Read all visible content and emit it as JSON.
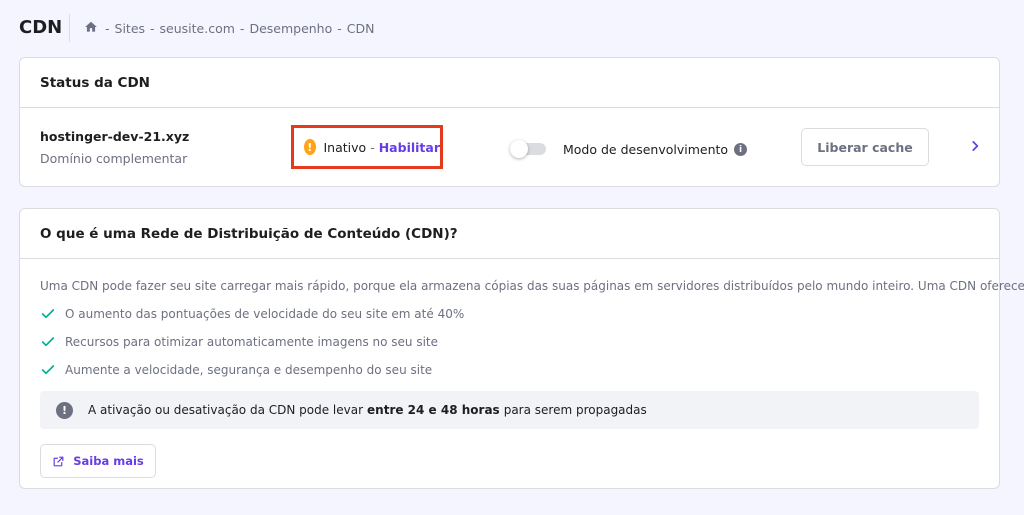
{
  "header": {
    "title": "CDN",
    "breadcrumb": [
      "Sites",
      "seusite.com",
      "Desempenho",
      "CDN"
    ],
    "separator": "-"
  },
  "status_card": {
    "title": "Status da CDN",
    "domain": "hostinger-dev-21.xyz",
    "domain_type": "Domínio complementar",
    "status": "Inativo",
    "status_separator": "-",
    "enable_label": "Habilitar",
    "dev_mode_label": "Modo de desenvolvimento",
    "dev_mode_enabled": false,
    "purge_label": "Liberar cache"
  },
  "info_card": {
    "title": "O que é uma Rede de Distribuição de Conteúdo (CDN)?",
    "intro": "Uma CDN pode fazer seu site carregar mais rápido, porque ela armazena cópias das suas páginas em servidores distribuídos pelo mundo inteiro. Uma CDN oferece:",
    "benefits": [
      "O aumento das pontuações de velocidade do seu site em até 40%",
      "Recursos para otimizar automaticamente imagens no seu site",
      "Aumente a velocidade, segurança e desempenho do seu site"
    ],
    "notice_before": "A ativação ou desativação da CDN pode levar",
    "notice_bold": "entre 24 e 48 horas",
    "notice_after": "para serem propagadas",
    "learn_more_label": "Saiba mais"
  },
  "icons": {
    "home": "home-icon",
    "warning": "warning-icon",
    "info": "info-icon",
    "chevron": "chevron-right-icon",
    "check": "check-icon",
    "notice": "exclamation-icon",
    "external": "external-link-icon"
  },
  "colors": {
    "accent": "#673de6",
    "warning": "#fea419",
    "success": "#00b090",
    "highlight_border": "#e53a1e"
  }
}
